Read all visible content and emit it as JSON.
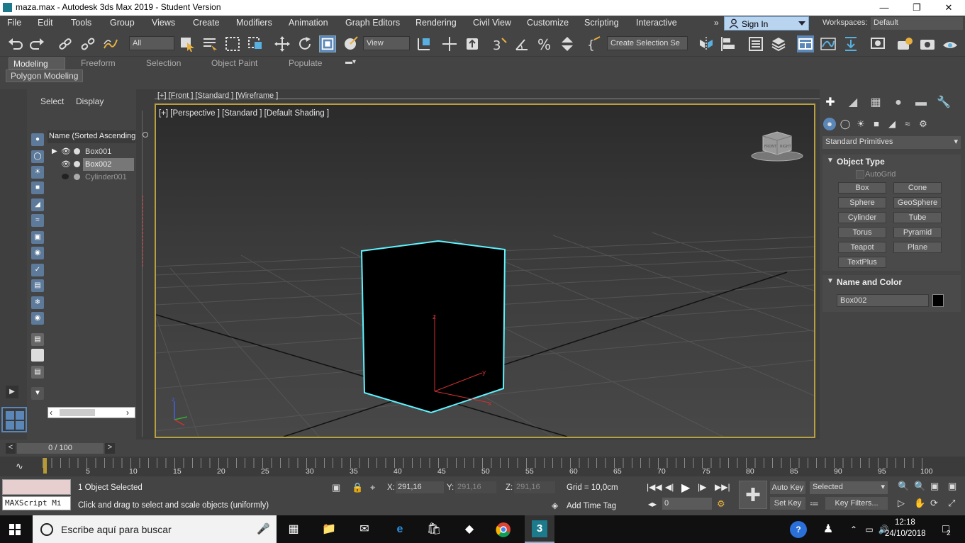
{
  "window": {
    "title": "maza.max - Autodesk 3ds Max 2019 - Student Version",
    "minimize": "—",
    "restore": "❐",
    "close": "✕"
  },
  "menubar": {
    "items": [
      "File",
      "Edit",
      "Tools",
      "Group",
      "Views",
      "Create",
      "Modifiers",
      "Animation",
      "Graph Editors",
      "Rendering",
      "Civil View",
      "Customize",
      "Scripting",
      "Interactive"
    ],
    "overflow": "»",
    "sign_in": "Sign In",
    "workspaces_label": "Workspaces:",
    "workspaces_value": "Default"
  },
  "toolbar": {
    "filter_value": "All",
    "refcoord_value": "View",
    "selection_set_placeholder": "Create Selection Se"
  },
  "ribbon": {
    "tabs": [
      "Modeling",
      "Freeform",
      "Selection",
      "Object Paint",
      "Populate"
    ],
    "active_tab": "Modeling",
    "sub_label": "Polygon Modeling"
  },
  "explorer": {
    "tabs": [
      "Select",
      "Display"
    ],
    "header": "Name (Sorted Ascending)",
    "rows": [
      {
        "name": "Box001",
        "selected": false,
        "visible": true
      },
      {
        "name": "Box002",
        "selected": true,
        "visible": true
      },
      {
        "name": "Cylinder001",
        "selected": false,
        "visible": false
      }
    ]
  },
  "viewport": {
    "front_label": "[+] [Front ] [Standard ] [Wireframe ]",
    "persp_label": "[+] [Perspective ] [Standard ] [Default Shading ]",
    "viewcube_front": "FRONT",
    "viewcube_right": "RIGHT",
    "axis_z": "z",
    "axis_y": "y",
    "axis_x": "x"
  },
  "command_panel": {
    "category": "Standard Primitives",
    "object_type_title": "Object Type",
    "autogrid": "AutoGrid",
    "buttons": [
      "Box",
      "Cone",
      "Sphere",
      "GeoSphere",
      "Cylinder",
      "Tube",
      "Torus",
      "Pyramid",
      "Teapot",
      "Plane",
      "TextPlus"
    ],
    "name_color_title": "Name and Color",
    "object_name": "Box002",
    "object_color": "#000000"
  },
  "timeline": {
    "frame_display": "0 / 100",
    "ticks": [
      "5",
      "10",
      "15",
      "20",
      "25",
      "30",
      "35",
      "40",
      "45",
      "50",
      "55",
      "60",
      "65",
      "70",
      "75",
      "80",
      "85",
      "90",
      "95",
      "100"
    ]
  },
  "status": {
    "selection": "1 Object Selected",
    "prompt": "Click and drag to select and scale objects (uniformly)",
    "maxscript": "MAXScript Mi",
    "x_label": "X:",
    "x_value": "291,16",
    "y_label": "Y:",
    "y_value": "291,16",
    "z_label": "Z:",
    "z_value": "291,16",
    "grid": "Grid = 10,0cm",
    "add_time_tag": "Add Time Tag",
    "auto_key": "Auto Key",
    "set_key": "Set Key",
    "selected_dropdown": "Selected",
    "key_filters": "Key Filters...",
    "frame_value": "0"
  },
  "taskbar": {
    "search_placeholder": "Escribe aquí para buscar",
    "time": "12:18",
    "date": "24/10/2018",
    "notifications": "2"
  },
  "colors": {
    "viewport_border": "#b8a040",
    "selection_wire": "#5ef3ff",
    "signin_bg": "#b9d4ef"
  }
}
